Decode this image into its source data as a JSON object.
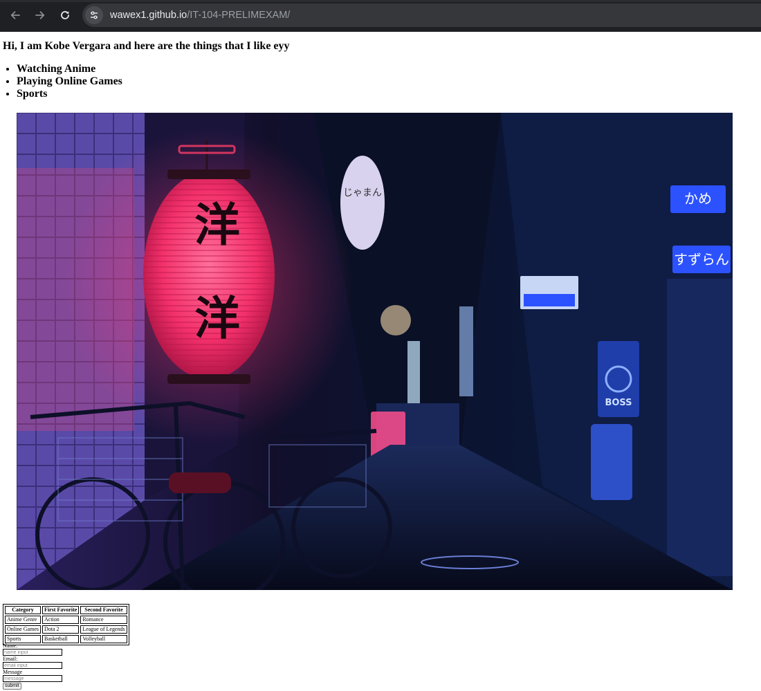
{
  "browser": {
    "url_host": "wawex1.github.io",
    "url_path": "/IT-104-PRELIMEXAM/",
    "icons": {
      "back": "arrow-left-icon",
      "forward": "arrow-right-icon",
      "reload": "reload-icon",
      "site_info": "tune-icon"
    }
  },
  "intro": {
    "heading": "Hi, I am Kobe Vergara and here are the things that I like eyy"
  },
  "likes": [
    "Watching Anime",
    "Playing Online Games",
    "Sports"
  ],
  "table": {
    "headers": [
      "Category",
      "First Favorite",
      "Second Favorite"
    ],
    "rows": [
      [
        "Anime Genre",
        "Action",
        "Romance"
      ],
      [
        "Online Games",
        "Dota 2",
        "League of Legends"
      ],
      [
        "Sports",
        "Basketball",
        "Volleyball"
      ]
    ]
  },
  "form": {
    "name_label": "Name:",
    "name_placeholder": "name input",
    "email_label": "Email:",
    "email_placeholder": "email input",
    "message_label": "Message",
    "message_placeholder": "message",
    "submit_label": "submit"
  }
}
